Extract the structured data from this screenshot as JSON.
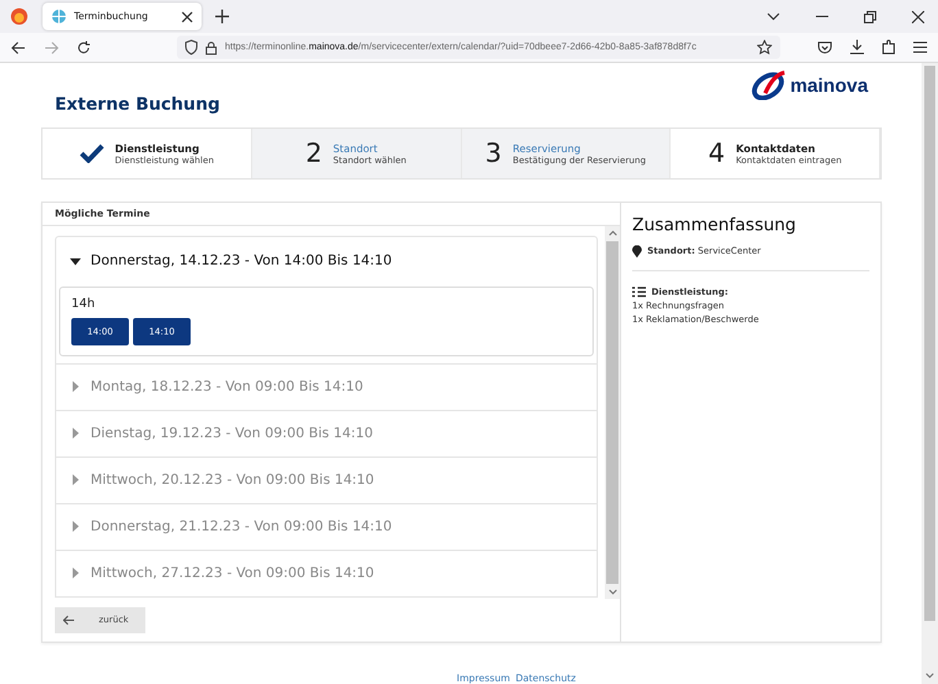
{
  "browser": {
    "tab_title": "Terminbuchung",
    "url_prefix": "https://terminonline.",
    "url_domain": "mainova.de",
    "url_rest": "/m/servicecenter/extern/calendar/?uid=70dbeee7-2d66-42b0-8a85-3af878d8f7c"
  },
  "page": {
    "title": "Externe Buchung",
    "logo_text": "mainova"
  },
  "steps": [
    {
      "title": "Dienstleistung",
      "subtitle": "Dienstleistung wählen",
      "kind": "done"
    },
    {
      "number": "2",
      "title": "Standort",
      "subtitle": "Standort wählen",
      "kind": "current"
    },
    {
      "number": "3",
      "title": "Reservierung",
      "subtitle": "Bestätigung der Reservierung",
      "kind": "current"
    },
    {
      "number": "4",
      "title": "Kontaktdaten",
      "subtitle": "Kontaktdaten eintragen",
      "kind": "pending"
    }
  ],
  "appointments": {
    "heading": "Mögliche Termine",
    "days": [
      {
        "label": "Donnerstag, 14.12.23 - Von 14:00 Bis 14:10",
        "expanded": true,
        "hours": [
          {
            "label": "14h",
            "slots": [
              "14:00",
              "14:10"
            ]
          }
        ]
      },
      {
        "label": "Montag, 18.12.23 - Von 09:00 Bis 14:10",
        "expanded": false
      },
      {
        "label": "Dienstag, 19.12.23 - Von 09:00 Bis 14:10",
        "expanded": false
      },
      {
        "label": "Mittwoch, 20.12.23 - Von 09:00 Bis 14:10",
        "expanded": false
      },
      {
        "label": "Donnerstag, 21.12.23 - Von 09:00 Bis 14:10",
        "expanded": false
      },
      {
        "label": "Mittwoch, 27.12.23 - Von 09:00 Bis 14:10",
        "expanded": false
      }
    ],
    "back_button": "zurück"
  },
  "summary": {
    "title": "Zusammenfassung",
    "location_label": "Standort:",
    "location_value": "ServiceCenter",
    "service_label": "Dienstleistung:",
    "services": [
      "1x Rechnungsfragen",
      "1x Reklamation/Beschwerde"
    ]
  },
  "footer": {
    "links": [
      "Impressum",
      "Datenschutz"
    ]
  }
}
